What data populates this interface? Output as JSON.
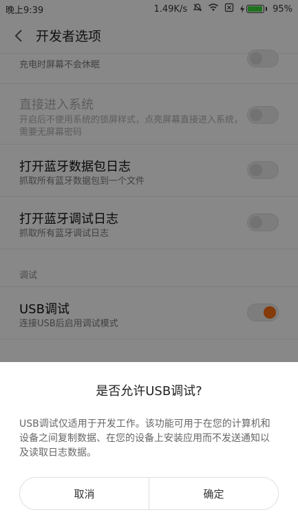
{
  "status": {
    "time": "晚上9:39",
    "speed": "1.49K/s",
    "battery": "95%"
  },
  "header": {
    "title": "开发者选项"
  },
  "rows": [
    {
      "subtitle": "充电时屏幕不会休眠"
    },
    {
      "title": "直接进入系统",
      "subtitle": "开启后不使用系统的锁屏样式，点亮屏幕直接进入系统，需要无屏幕密码"
    },
    {
      "title": "打开蓝牙数据包日志",
      "subtitle": "抓取所有蓝牙数据包到一个文件"
    },
    {
      "title": "打开蓝牙调试日志",
      "subtitle": "抓取所有蓝牙调试日志"
    }
  ],
  "section": {
    "label": "调试"
  },
  "usb_row": {
    "title": "USB调试",
    "subtitle": "连接USB后启用调试模式"
  },
  "dialog": {
    "title": "是否允许USB调试?",
    "message": "USB调试仅适用于开发工作。该功能可用于在您的计算机和设备之间复制数据、在您的设备上安装应用而不发送通知以及读取日志数据。",
    "cancel": "取消",
    "confirm": "确定"
  },
  "colors": {
    "accent": "#f26a12",
    "battery": "#3ad13a"
  }
}
